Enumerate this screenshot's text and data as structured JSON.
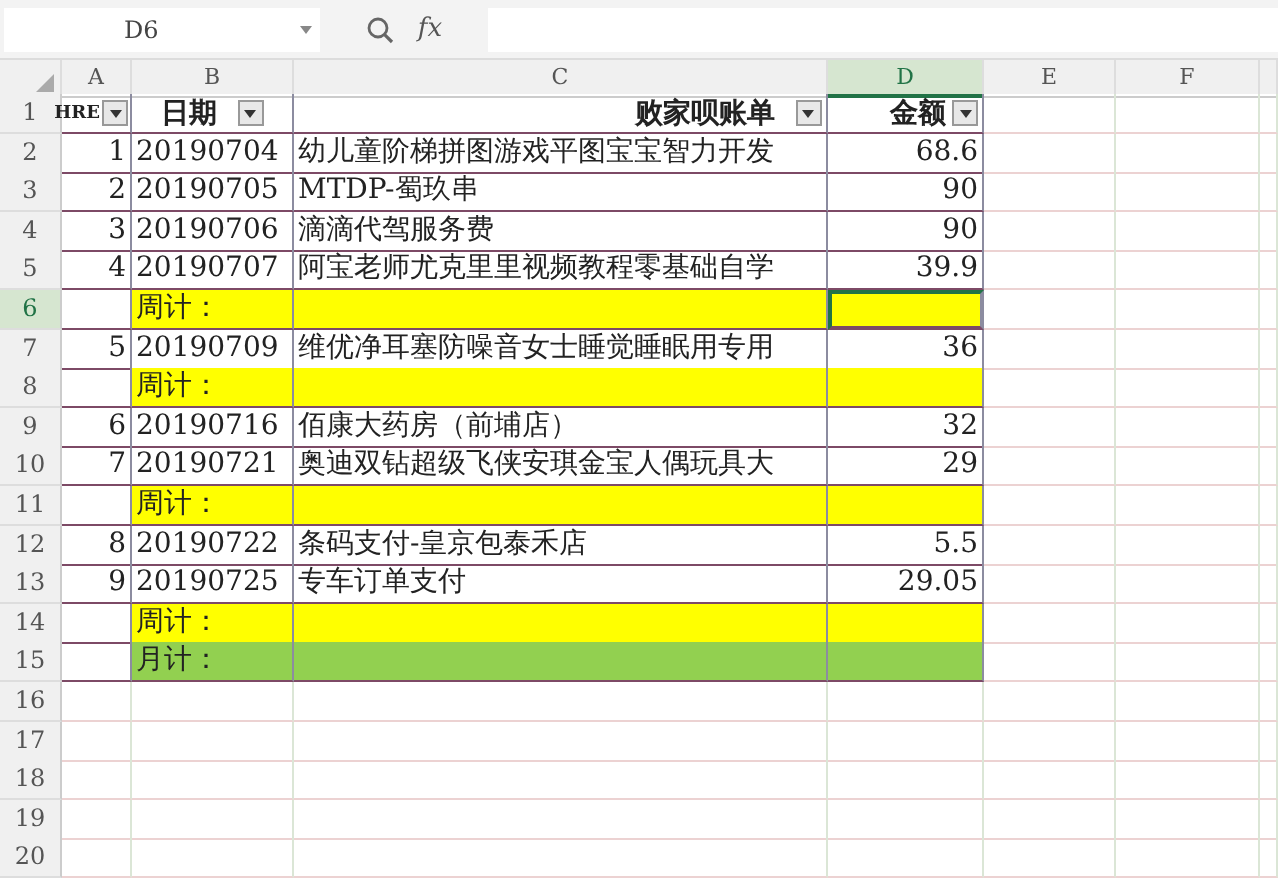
{
  "name_box": "D6",
  "formula_bar": {
    "fx": "fx"
  },
  "column_headers": [
    {
      "label": "A",
      "selected": false
    },
    {
      "label": "B",
      "selected": false
    },
    {
      "label": "C",
      "selected": false
    },
    {
      "label": "D",
      "selected": true
    },
    {
      "label": "E",
      "selected": false
    },
    {
      "label": "F",
      "selected": false
    }
  ],
  "rows": [
    {
      "number": "1",
      "kind": "header",
      "selected": false,
      "columns": [
        "HRE",
        "日期",
        "败家呗账单",
        "金额"
      ]
    },
    {
      "number": "2",
      "kind": "data",
      "selected": false,
      "index": "1",
      "date": "20190704",
      "item": "幼儿童阶梯拼图游戏平图宝宝智力开发",
      "amount": "68.6"
    },
    {
      "number": "3",
      "kind": "data",
      "selected": false,
      "index": "2",
      "date": "20190705",
      "item": "MTDP-蜀玖串",
      "amount": "90"
    },
    {
      "number": "4",
      "kind": "data",
      "selected": false,
      "index": "3",
      "date": "20190706",
      "item": "滴滴代驾服务费",
      "amount": "90"
    },
    {
      "number": "5",
      "kind": "data",
      "selected": false,
      "index": "4",
      "date": "20190707",
      "item": "阿宝老师尤克里里视频教程零基础自学",
      "amount": "39.9"
    },
    {
      "number": "6",
      "kind": "subtotal",
      "selected": true,
      "label": "周计："
    },
    {
      "number": "7",
      "kind": "data",
      "selected": false,
      "index": "5",
      "date": "20190709",
      "item": "维优净耳塞防噪音女士睡觉睡眠用专用",
      "amount": "36"
    },
    {
      "number": "8",
      "kind": "subtotal",
      "selected": false,
      "label": "周计："
    },
    {
      "number": "9",
      "kind": "data",
      "selected": false,
      "index": "6",
      "date": "20190716",
      "item": "佰康大药房（前埔店）",
      "amount": "32"
    },
    {
      "number": "10",
      "kind": "data",
      "selected": false,
      "index": "7",
      "date": "20190721",
      "item": "奥迪双钻超级飞侠安琪金宝人偶玩具大",
      "amount": "29"
    },
    {
      "number": "11",
      "kind": "subtotal",
      "selected": false,
      "label": "周计："
    },
    {
      "number": "12",
      "kind": "data",
      "selected": false,
      "index": "8",
      "date": "20190722",
      "item": "条码支付-皇京包泰禾店",
      "amount": "5.5"
    },
    {
      "number": "13",
      "kind": "data",
      "selected": false,
      "index": "9",
      "date": "20190725",
      "item": "专车订单支付",
      "amount": "29.05"
    },
    {
      "number": "14",
      "kind": "subtotal",
      "selected": false,
      "label": "周计："
    },
    {
      "number": "15",
      "kind": "total",
      "selected": false,
      "label": "月计："
    },
    {
      "number": "16",
      "kind": "empty",
      "selected": false
    },
    {
      "number": "17",
      "kind": "empty",
      "selected": false
    },
    {
      "number": "18",
      "kind": "empty",
      "selected": false
    },
    {
      "number": "19",
      "kind": "empty",
      "selected": false
    },
    {
      "number": "20",
      "kind": "empty",
      "selected": false
    }
  ]
}
